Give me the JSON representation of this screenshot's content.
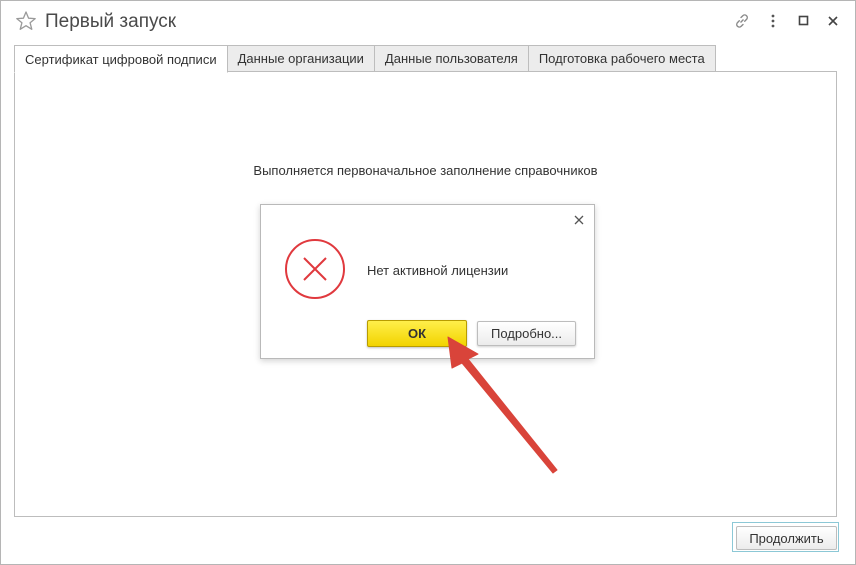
{
  "window": {
    "title": "Первый запуск"
  },
  "toolbar": {
    "link_icon": "link-icon",
    "more_icon": "more-vertical-icon",
    "maximize_icon": "maximize-icon",
    "close_icon": "close-icon"
  },
  "tabs": [
    {
      "label": "Сертификат цифровой подписи",
      "active": true
    },
    {
      "label": "Данные организации",
      "active": false
    },
    {
      "label": "Данные пользователя",
      "active": false
    },
    {
      "label": "Подготовка рабочего места",
      "active": false
    }
  ],
  "main": {
    "status": "Выполняется первоначальное заполнение справочников"
  },
  "dialog": {
    "message": "Нет активной лицензии",
    "ok_label": "ОК",
    "details_label": "Подробно...",
    "icon": "error-icon",
    "error_color": "#e0393e"
  },
  "footer": {
    "continue_label": "Продолжить"
  },
  "annotation": {
    "arrow_color": "#d9443a"
  }
}
